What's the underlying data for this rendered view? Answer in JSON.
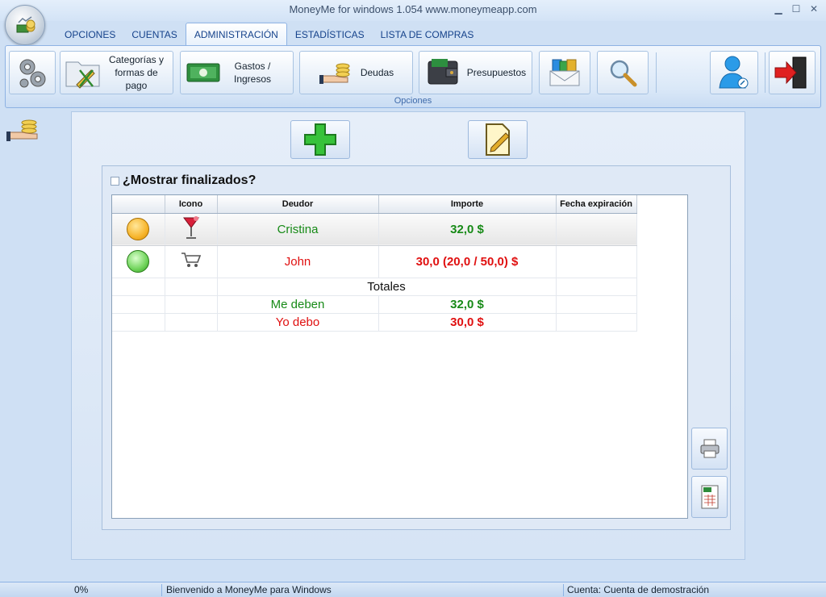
{
  "window": {
    "title": "MoneyMe for windows 1.054 www.moneymeapp.com",
    "controls": [
      "minimize-icon",
      "maximize-icon",
      "close-icon"
    ]
  },
  "tabs": [
    {
      "label": "OPCIONES",
      "active": false
    },
    {
      "label": "CUENTAS",
      "active": false
    },
    {
      "label": "ADMINISTRACIÓN",
      "active": true
    },
    {
      "label": "ESTADÍSTICAS",
      "active": false
    },
    {
      "label": "LISTA DE COMPRAS",
      "active": false
    }
  ],
  "ribbon": {
    "caption": "Opciones",
    "buttons": {
      "settings": {
        "icon": "gears-icon"
      },
      "categories": {
        "label": "Categorías y formas de pago",
        "icon": "folder-edit-icon"
      },
      "expenses": {
        "label": "Gastos / Ingresos",
        "icon": "money-icon"
      },
      "debts": {
        "label": "Deudas",
        "icon": "hand-coins-icon"
      },
      "budgets": {
        "label": "Presupuestos",
        "icon": "wallet-icon"
      },
      "mail": {
        "icon": "money-envelope-icon"
      },
      "search": {
        "icon": "magnifier-icon"
      },
      "user": {
        "icon": "user-icon"
      },
      "exit": {
        "icon": "exit-door-icon"
      }
    }
  },
  "toolbar": {
    "add_icon": "plus-icon",
    "edit_icon": "edit-document-icon"
  },
  "filter": {
    "show_finished_label": "¿Mostrar finalizados?",
    "checked": false
  },
  "table": {
    "headers": [
      "",
      "Icono",
      "Deudor",
      "Importe",
      "Fecha expiración"
    ],
    "rows": [
      {
        "status": "orange",
        "icon": "cocktail-icon",
        "debtor": "Cristina",
        "amount": "32,0 $",
        "expires": "",
        "color": "green",
        "selected": true
      },
      {
        "status": "green",
        "icon": "cart-icon",
        "debtor": "John",
        "amount": "30,0 (20,0 / 50,0) $",
        "expires": "",
        "color": "red",
        "selected": false
      }
    ],
    "totals": {
      "label": "Totales",
      "owed_to_me_label": "Me deben",
      "owed_to_me_value": "32,0 $",
      "i_owe_label": "Yo debo",
      "i_owe_value": "30,0 $"
    }
  },
  "side_buttons": {
    "print_icon": "printer-icon",
    "export_icon": "excel-export-icon"
  },
  "statusbar": {
    "progress": "0%",
    "message": "Bienvenido a MoneyMe para Windows",
    "account": "Cuenta: Cuenta de demostración"
  },
  "colors": {
    "positive": "#178a17",
    "negative": "#e01010",
    "ribbon_border": "#8db2e3"
  }
}
